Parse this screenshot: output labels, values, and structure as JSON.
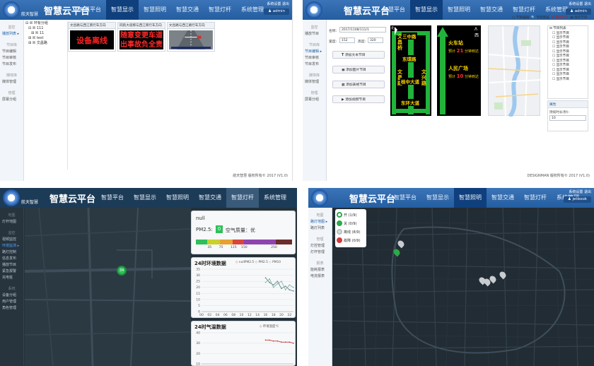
{
  "app": {
    "logo_text": "航天智慧",
    "brand": "智慧云平台",
    "nav": [
      "智慧平台",
      "智慧显示",
      "智慧照明",
      "智慧交通",
      "智慧灯杆",
      "系统管理"
    ],
    "user_links": "系统设置 退出",
    "user_name": "admin",
    "user_name_q4": "jetbook"
  },
  "q1": {
    "sidebar": [
      "监控",
      "播放列表",
      "节目库",
      "节目编辑",
      "节目审核",
      "节目发布",
      "媒体库",
      "媒体管理",
      "管理",
      "屏幕分组"
    ],
    "tree": [
      "⊟ ☒ 环有分组",
      "  ⊟ ☒ 111",
      "    ⊞ ☒ 11",
      "  ⊞ ☒ test",
      "  ⊞ ☒ 文昌路"
    ],
    "panels": [
      {
        "title": "文昌路与西江南行车方向",
        "lines": [
          "设备离线"
        ]
      },
      {
        "title": "同航大道那与西江南行车方向",
        "lines": [
          "随意变更车道",
          "出事故负全责"
        ]
      },
      {
        "title": "文昌路与西江路行车方向",
        "lines": []
      }
    ],
    "footer": "航天智慧 版权所有© 2017 (V1.0)"
  },
  "q2": {
    "sidebar": [
      "监控",
      "播放节目",
      "节目库",
      "节目编辑",
      "节目审核",
      "节目发布",
      "媒体库",
      "媒体管理",
      "管理",
      "屏幕分组"
    ],
    "toolbar": [
      "节目编辑",
      "节目预览",
      "删除节目",
      "保存节目"
    ],
    "name_label": "名称:",
    "name_value": "2017/1108/111/1",
    "w_label": "宽度:",
    "w_value": "152",
    "h_label": "高度:",
    "h_value": "320",
    "buttons": [
      "添加文本节目",
      "添加图片节目",
      "添加表格节目",
      "添加视频节目"
    ],
    "sign1": {
      "left": [
        "文",
        "昌",
        "桥"
      ],
      "mid": [
        "三中路",
        "东環路",
        "桂中大道",
        "东环大道"
      ],
      "left2": [
        "文",
        "昌",
        "路"
      ],
      "right": [
        "文",
        "兴",
        "路"
      ],
      "north": "北"
    },
    "sign2": {
      "line1_a": "火车站",
      "line1_b": "预计",
      "line1_n": "21",
      "line1_c": "分钟到达",
      "line2_a": "人民广场",
      "line2_b": "预计",
      "line2_n": "10",
      "line2_c": "分钟到达",
      "north": "西"
    },
    "tree_items": [
      "⊟ 节目列表",
      "☐ 显示节目",
      "☐ 显示节目",
      "☐ 显示节目",
      "☐ 显示节目",
      "☐ 显示节目",
      "☐ 显示节目",
      "☐ 显示节目",
      "☐ 显示节目",
      "☐ 显示节目",
      "☐ 显示节目",
      "☐ 显示节目"
    ],
    "prop_title": "属性",
    "prop_label": "持续时长(秒):",
    "prop_value": "10",
    "footer": "DESIGNMAN 版权所有© 2017 (V1.0)"
  },
  "q3": {
    "sidebar": [
      "地图",
      "灯杆地图",
      "监控",
      "视频监控",
      "环境监测",
      "路灯控制",
      "信息发布",
      "播放节目",
      "紧急报警",
      "充电桩",
      "系统",
      "设备分组",
      "用户管理",
      "角色管理"
    ],
    "marker_count": "34",
    "pm_label": "PM2.5:",
    "pm_value": "0",
    "aq_label": "空气质量：优",
    "null_text": "null",
    "scale_ticks": [
      "35",
      "75",
      "115",
      "150",
      "250"
    ],
    "env_title": "24时环境数据",
    "env_legend": [
      "nullPM2.5",
      "PM2.5",
      "PM10"
    ],
    "env_y": [
      "35",
      "30",
      "25",
      "20",
      "15",
      "10",
      "5",
      "0"
    ],
    "env_x": [
      "00",
      "02",
      "04",
      "06",
      "08",
      "10",
      "12",
      "14",
      "16",
      "18",
      "20",
      "22"
    ],
    "temp_title": "24时气温数据",
    "temp_legend": "环境温度℃",
    "temp_y": [
      "40",
      "30",
      "20",
      "10"
    ]
  },
  "q4": {
    "sidebar": [
      "地图",
      "路灯地图",
      "路灯列表",
      "管理",
      "灯控管理",
      "灯杆管理",
      "报表",
      "能耗报表",
      "电流报表"
    ],
    "legend": [
      {
        "label": "开 (1/9)",
        "color": "#2ea84a"
      },
      {
        "label": "关 (0/9)",
        "color": "#2ea84a"
      },
      {
        "label": "离线 (8/9)",
        "color": "#b8bec4"
      },
      {
        "label": "故障 (0/9)",
        "color": "#d23a3a"
      }
    ]
  },
  "chart_data": [
    {
      "type": "line",
      "title": "24时环境数据",
      "x": [
        "00",
        "01",
        "02",
        "03",
        "04",
        "05",
        "06",
        "07",
        "08",
        "09",
        "10",
        "11",
        "12",
        "13",
        "14",
        "15",
        "16",
        "17",
        "18",
        "19",
        "20",
        "21",
        "22",
        "23"
      ],
      "ylim": [
        0,
        35
      ],
      "series": [
        {
          "name": "PM2.5",
          "values": [
            null,
            null,
            null,
            null,
            null,
            null,
            null,
            null,
            null,
            null,
            null,
            null,
            null,
            null,
            null,
            null,
            28,
            24,
            22,
            25,
            19,
            21,
            18,
            17
          ]
        },
        {
          "name": "PM10",
          "values": [
            null,
            null,
            null,
            null,
            null,
            null,
            null,
            null,
            null,
            null,
            null,
            null,
            null,
            null,
            null,
            null,
            24,
            27,
            20,
            23,
            25,
            18,
            22,
            20
          ]
        }
      ],
      "colors": {
        "PM2.5": "#5a8a8c",
        "PM10": "#8ab0a8"
      }
    },
    {
      "type": "line",
      "title": "24时气温数据",
      "x": [
        "00",
        "01",
        "02",
        "03",
        "04",
        "05",
        "06",
        "07",
        "08",
        "09",
        "10",
        "11",
        "12",
        "13",
        "14",
        "15",
        "16",
        "17",
        "18",
        "19",
        "20",
        "21",
        "22",
        "23"
      ],
      "ylim": [
        10,
        40
      ],
      "series": [
        {
          "name": "环境温度℃",
          "values": [
            null,
            null,
            null,
            null,
            null,
            null,
            null,
            null,
            null,
            null,
            null,
            null,
            null,
            null,
            null,
            null,
            33,
            33,
            32,
            32,
            31,
            31,
            31,
            30
          ]
        }
      ],
      "colors": {
        "环境温度℃": "#c44040"
      }
    }
  ]
}
